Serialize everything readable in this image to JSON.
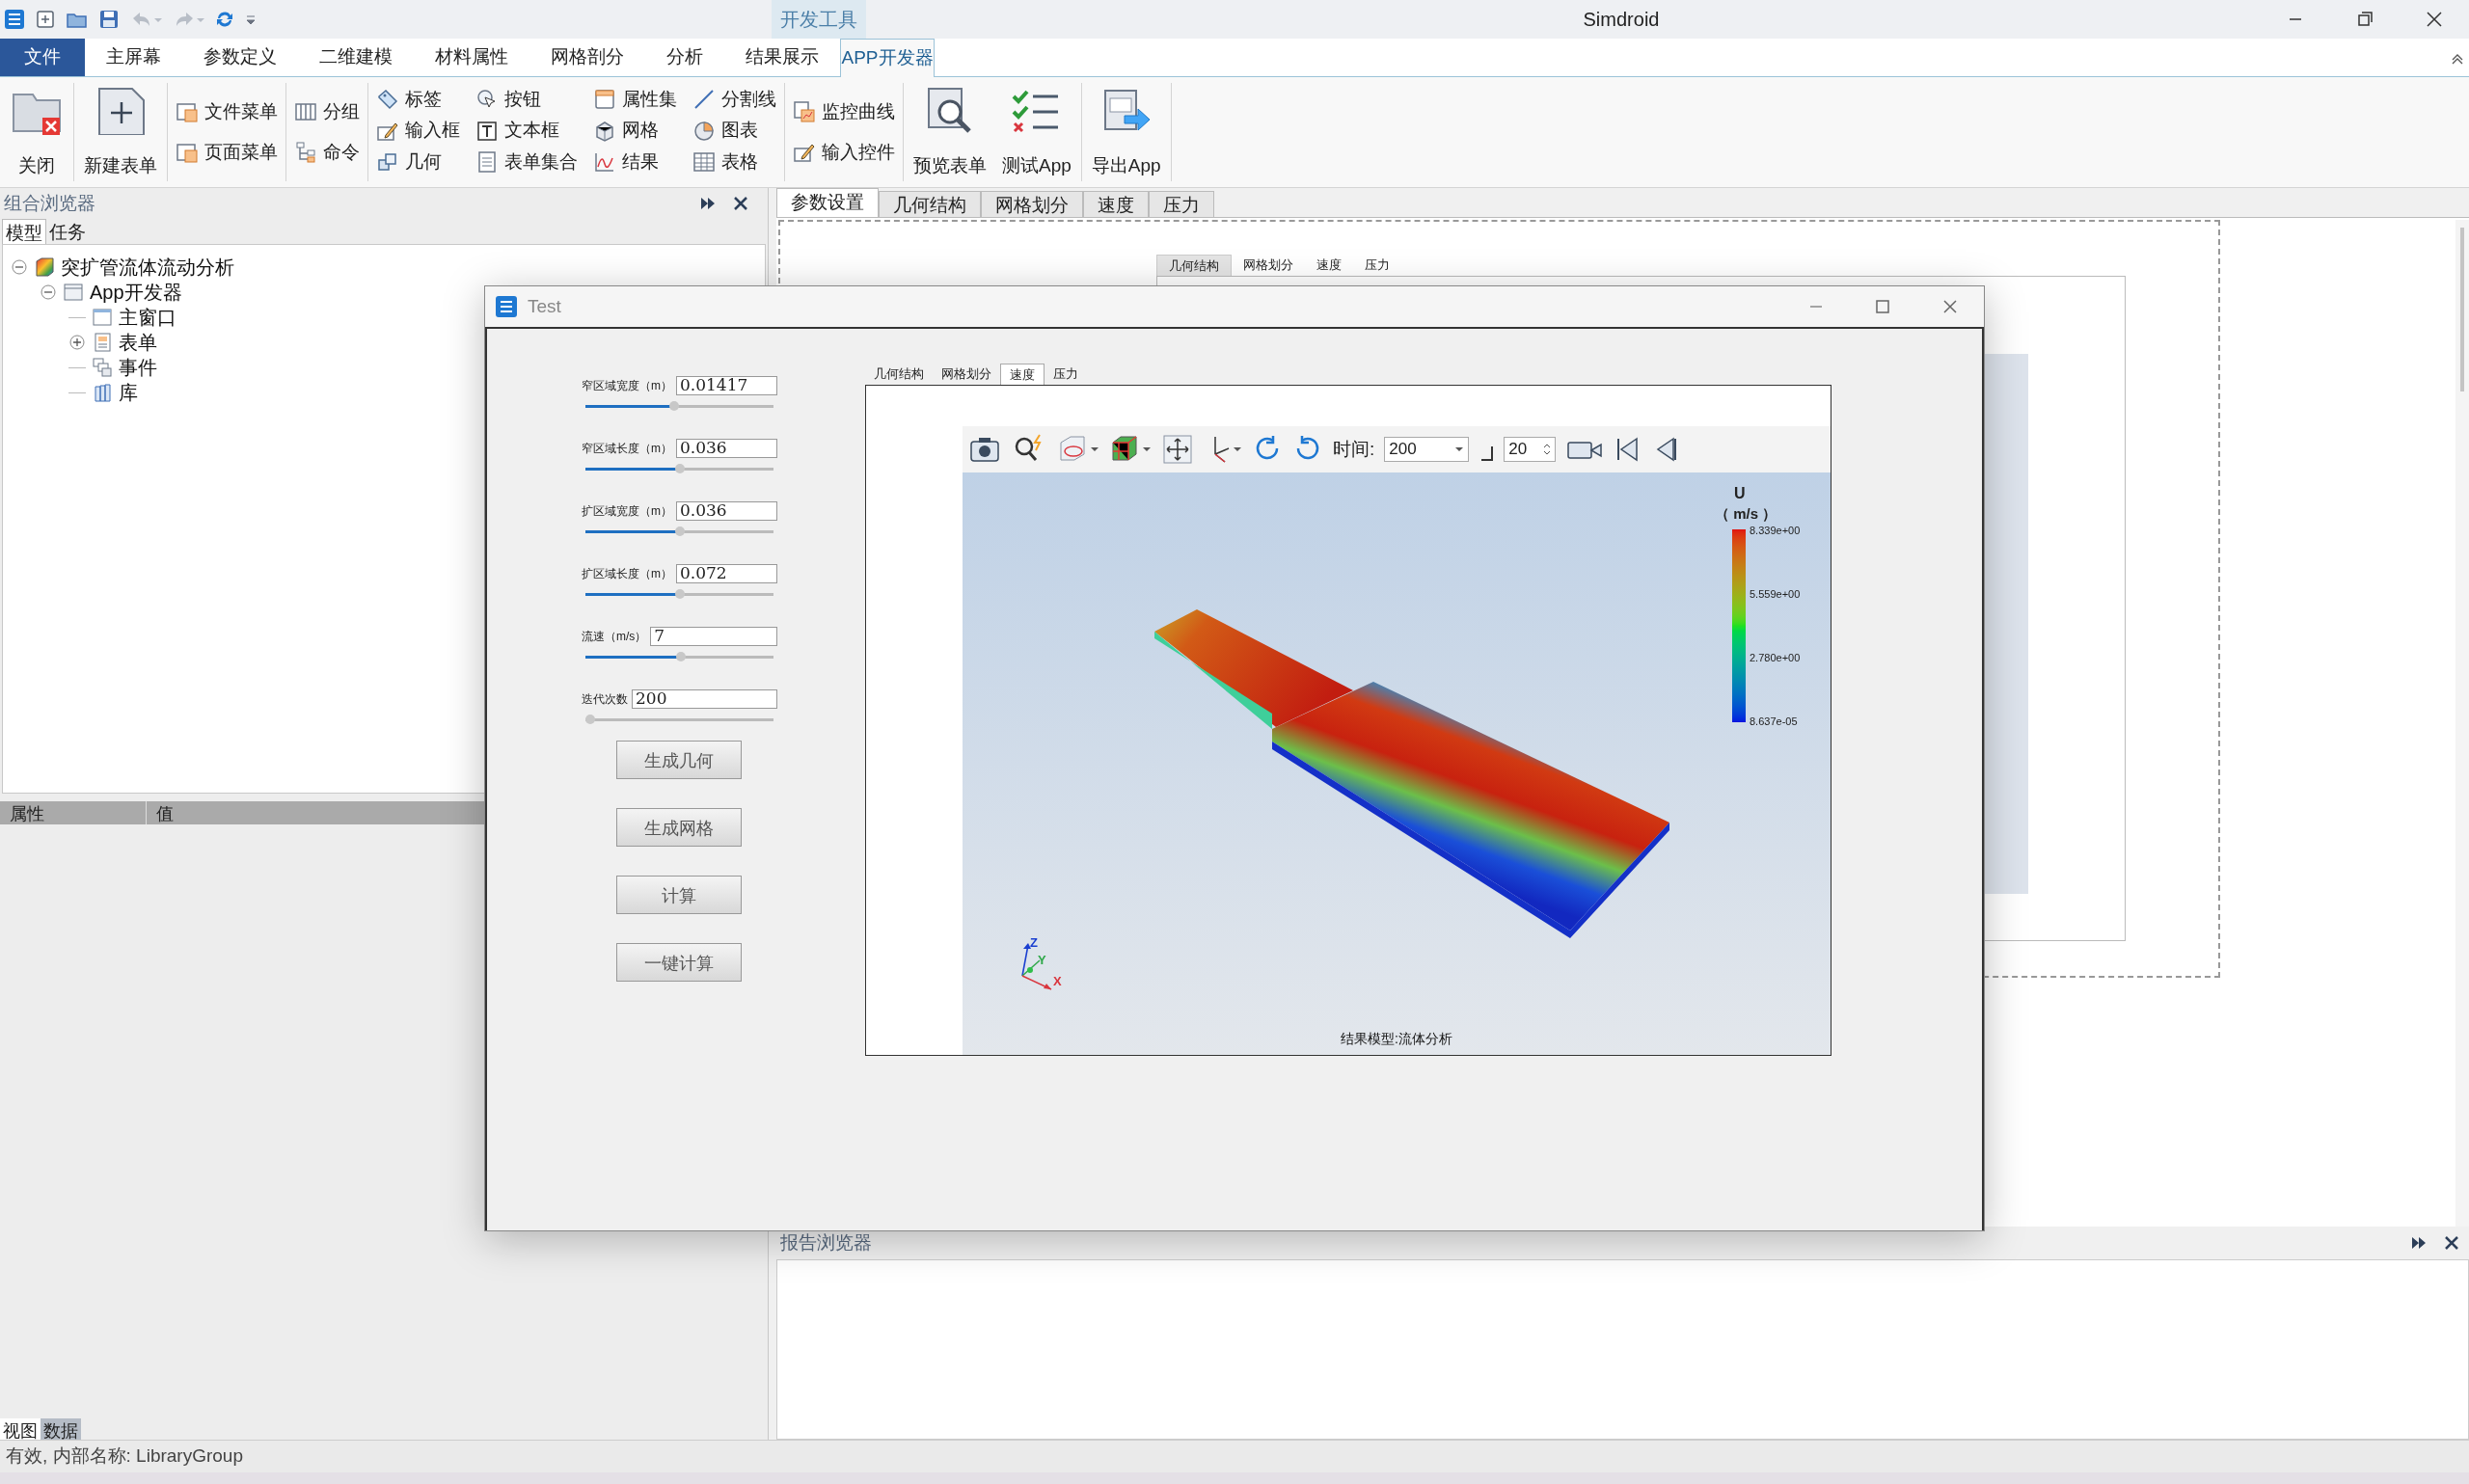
{
  "window": {
    "title": "Simdroid",
    "context_tab": "开发工具"
  },
  "file_menu": "文件",
  "menu_tabs": [
    {
      "label": "主屏幕",
      "selected": false
    },
    {
      "label": "参数定义",
      "selected": false
    },
    {
      "label": "二维建模",
      "selected": false
    },
    {
      "label": "材料属性",
      "selected": false
    },
    {
      "label": "网格剖分",
      "selected": false
    },
    {
      "label": "分析",
      "selected": false
    },
    {
      "label": "结果展示",
      "selected": false
    },
    {
      "label": "APP开发器",
      "selected": true
    }
  ],
  "ribbon": [
    {
      "kind": "large",
      "items": [
        {
          "label": "关闭",
          "kind": "close"
        }
      ]
    },
    {
      "kind": "large",
      "items": [
        {
          "label": "新建表单",
          "kind": "new"
        }
      ]
    },
    {
      "kind": "small",
      "items": [
        {
          "label": "文件菜单",
          "kind": "menu"
        },
        {
          "label": "页面菜单",
          "kind": "menu"
        }
      ]
    },
    {
      "kind": "small",
      "items": [
        {
          "label": "分组",
          "kind": "group"
        },
        {
          "label": "命令",
          "kind": "tree"
        }
      ]
    },
    {
      "kind": "grid",
      "items": [
        {
          "label": "标签",
          "kind": "tag"
        },
        {
          "label": "输入框",
          "kind": "edit"
        },
        {
          "label": "几何",
          "kind": "shape"
        },
        {
          "label": "按钮",
          "kind": "pointer"
        },
        {
          "label": "文本框",
          "kind": "text"
        },
        {
          "label": "表单集合",
          "kind": "doc"
        },
        {
          "label": "属性集",
          "kind": "panel"
        },
        {
          "label": "网格",
          "kind": "cube"
        },
        {
          "label": "结果",
          "kind": "curve"
        },
        {
          "label": "分割线",
          "kind": "line"
        },
        {
          "label": "图表",
          "kind": "pie"
        },
        {
          "label": "表格",
          "kind": "table"
        }
      ]
    },
    {
      "kind": "small",
      "items": [
        {
          "label": "监控曲线",
          "kind": "monitor"
        },
        {
          "label": "输入控件",
          "kind": "edit"
        }
      ]
    },
    {
      "kind": "large",
      "items": [
        {
          "label": "预览表单",
          "kind": "preview"
        },
        {
          "label": "测试App",
          "kind": "checklist"
        }
      ]
    },
    {
      "kind": "large",
      "items": [
        {
          "label": "导出App",
          "kind": "export"
        }
      ]
    }
  ],
  "left_panel": {
    "title": "组合浏览器",
    "tabs": [
      {
        "label": "模型",
        "selected": true
      },
      {
        "label": "任务",
        "selected": false
      }
    ],
    "tree": [
      {
        "label": "突扩管流体流动分析",
        "kind": "model",
        "expanded": true,
        "children": [
          {
            "label": "App开发器",
            "kind": "app",
            "expanded": true,
            "children": [
              {
                "label": "主窗口",
                "kind": "window"
              },
              {
                "label": "表单",
                "kind": "form",
                "expanded": false
              },
              {
                "label": "事件",
                "kind": "event"
              },
              {
                "label": "库",
                "kind": "library"
              }
            ]
          }
        ]
      }
    ]
  },
  "properties": {
    "columns": [
      "属性",
      "值"
    ]
  },
  "bottom_tabs": [
    {
      "label": "视图",
      "selected": false
    },
    {
      "label": "数据",
      "selected": true
    }
  ],
  "status_bar": "有效, 内部名称: LibraryGroup",
  "editor": {
    "tabs": [
      {
        "label": "参数设置",
        "selected": true
      },
      {
        "label": "几何结构",
        "selected": false
      },
      {
        "label": "网格划分",
        "selected": false
      },
      {
        "label": "速度",
        "selected": false
      },
      {
        "label": "压力",
        "selected": false
      }
    ],
    "preview_tabs": [
      {
        "label": "几何结构",
        "selected": true
      },
      {
        "label": "网格划分",
        "selected": false
      },
      {
        "label": "速度",
        "selected": false
      },
      {
        "label": "压力",
        "selected": false
      }
    ]
  },
  "report_browser": {
    "title": "报告浏览器"
  },
  "dialog": {
    "title": "Test",
    "fields": [
      {
        "label": "窄区域宽度（m）",
        "value": "0.01417",
        "level": 0.47
      },
      {
        "label": "窄区域长度（m）",
        "value": "0.036",
        "level": 0.5
      },
      {
        "label": "扩区域宽度（m）",
        "value": "0.036",
        "level": 0.5
      },
      {
        "label": "扩区域长度（m）",
        "value": "0.072",
        "level": 0.5
      },
      {
        "label": "流速（m/s）",
        "value": "7",
        "level": 0.51
      },
      {
        "label": "迭代次数",
        "value": "200",
        "level": 0
      }
    ],
    "buttons": [
      "生成几何",
      "生成网格",
      "计算",
      "一键计算"
    ],
    "tabs": [
      {
        "label": "几何结构",
        "selected": false
      },
      {
        "label": "网格划分",
        "selected": false
      },
      {
        "label": "速度",
        "selected": true
      },
      {
        "label": "压力",
        "selected": false
      }
    ],
    "toolbar": {
      "time_label": "时间:",
      "time_value": "200",
      "step_value": "20"
    },
    "viewer": {
      "caption": "结果模型:流体分析",
      "legend_title": "U",
      "legend_unit": "（ m/s ）",
      "legend_labels": [
        "8.339e+00",
        "5.559e+00",
        "2.780e+00",
        "8.637e-05"
      ],
      "axes": [
        "Z",
        "Y",
        "X"
      ]
    }
  }
}
